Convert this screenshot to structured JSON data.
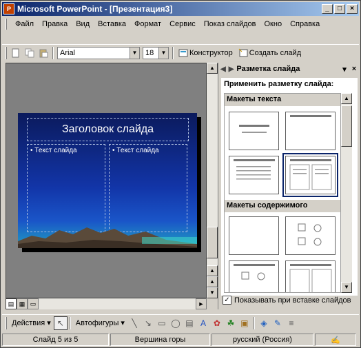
{
  "window": {
    "title": "Microsoft PowerPoint - [Презентация3]"
  },
  "menu": {
    "items": [
      "Файл",
      "Правка",
      "Вид",
      "Вставка",
      "Формат",
      "Сервис",
      "Показ слайдов",
      "Окно",
      "Справка"
    ]
  },
  "toolbar": {
    "font_name": "Arial",
    "font_size": "18",
    "designer_label": "Конструктор",
    "new_slide_label": "Создать слайд"
  },
  "slide": {
    "title": "Заголовок слайда",
    "left_text": "Текст слайда",
    "right_text": "Текст слайда"
  },
  "taskpane": {
    "title": "Разметка слайда",
    "apply_label": "Применить разметку слайда:",
    "section_text": "Макеты текста",
    "section_content": "Макеты содержимого",
    "show_on_insert": "Показывать при вставке слайдов"
  },
  "drawbar": {
    "actions_label": "Действия",
    "autoshapes_label": "Автофигуры"
  },
  "status": {
    "slide_pos": "Слайд 5 из 5",
    "design": "Вершина горы",
    "language": "русский (Россия)"
  },
  "colors": {
    "title_active": "#0a246a",
    "slide_bg_top": "#0b1a5c",
    "slide_bg_bottom": "#20a0c0"
  }
}
